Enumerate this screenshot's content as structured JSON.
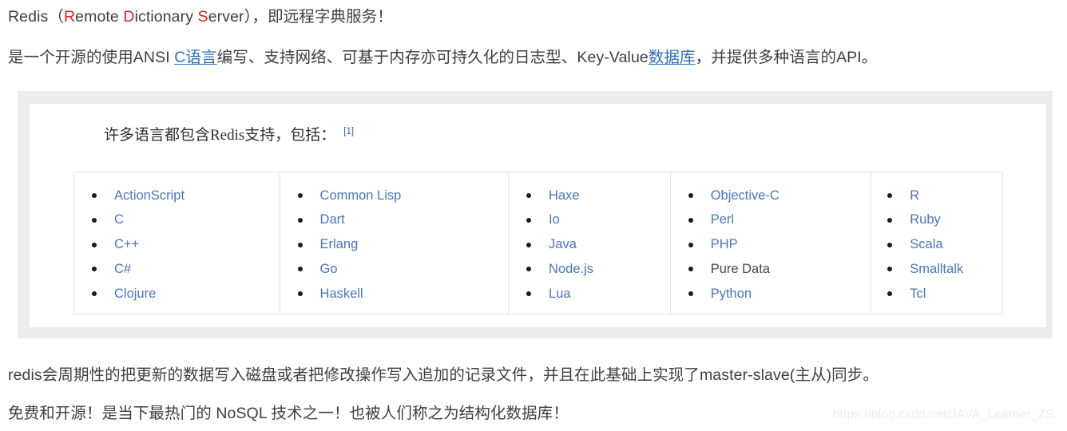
{
  "paragraphs": {
    "line1": {
      "seg1": "Redis（",
      "r": "R",
      "seg2": "emote ",
      "d": "D",
      "seg3": "ictionary ",
      "s": "S",
      "seg4": "erver），即远程字典服务！"
    },
    "line2": {
      "seg1": "是一个开源的使用ANSI ",
      "link1": "C语言",
      "seg2": "编写、支持网络、可基于内存亦可持久化的日志型、Key-Value",
      "link2": "数据库",
      "seg3": "，并提供多种语言的API。"
    },
    "line3": "redis会周期性的把更新的数据写入磁盘或者把修改操作写入追加的记录文件，并且在此基础上实现了master-slave(主从)同步。",
    "line4": "免费和开源！是当下最热门的 NoSQL 技术之一！也被人们称之为结构化数据库！"
  },
  "figure": {
    "heading": "许多语言都包含Redis支持，包括：",
    "citation": "[1]",
    "columns": [
      {
        "items": [
          {
            "label": "ActionScript",
            "is_link": true
          },
          {
            "label": "C",
            "is_link": true
          },
          {
            "label": "C++",
            "is_link": true
          },
          {
            "label": "C#",
            "is_link": true
          },
          {
            "label": "Clojure",
            "is_link": true
          }
        ]
      },
      {
        "items": [
          {
            "label": "Common Lisp",
            "is_link": true
          },
          {
            "label": "Dart",
            "is_link": true
          },
          {
            "label": "Erlang",
            "is_link": true
          },
          {
            "label": "Go",
            "is_link": true
          },
          {
            "label": "Haskell",
            "is_link": true
          }
        ]
      },
      {
        "items": [
          {
            "label": "Haxe",
            "is_link": true
          },
          {
            "label": "Io",
            "is_link": true
          },
          {
            "label": "Java",
            "is_link": true
          },
          {
            "label": "Node.js",
            "is_link": true
          },
          {
            "label": "Lua",
            "is_link": true
          }
        ]
      },
      {
        "items": [
          {
            "label": "Objective-C",
            "is_link": true
          },
          {
            "label": "Perl",
            "is_link": true
          },
          {
            "label": "PHP",
            "is_link": true
          },
          {
            "label": "Pure Data",
            "is_link": false
          },
          {
            "label": "Python",
            "is_link": true
          }
        ]
      },
      {
        "items": [
          {
            "label": "R",
            "is_link": true
          },
          {
            "label": "Ruby",
            "is_link": true
          },
          {
            "label": "Scala",
            "is_link": true
          },
          {
            "label": "Smalltalk",
            "is_link": true
          },
          {
            "label": "Tcl",
            "is_link": true
          }
        ]
      }
    ]
  },
  "watermark": "https://blog.csdn.net/JAVA_Learner_ZS",
  "colors": {
    "accent_red": "#e02020",
    "link_blue": "#2f6fb5",
    "list_link_blue": "#4a76bd",
    "citation_blue": "#3366bb",
    "text": "#3f3f3f",
    "figure_frame": "#ececed",
    "table_border": "#e2e2ec",
    "watermark": "#ededed"
  }
}
